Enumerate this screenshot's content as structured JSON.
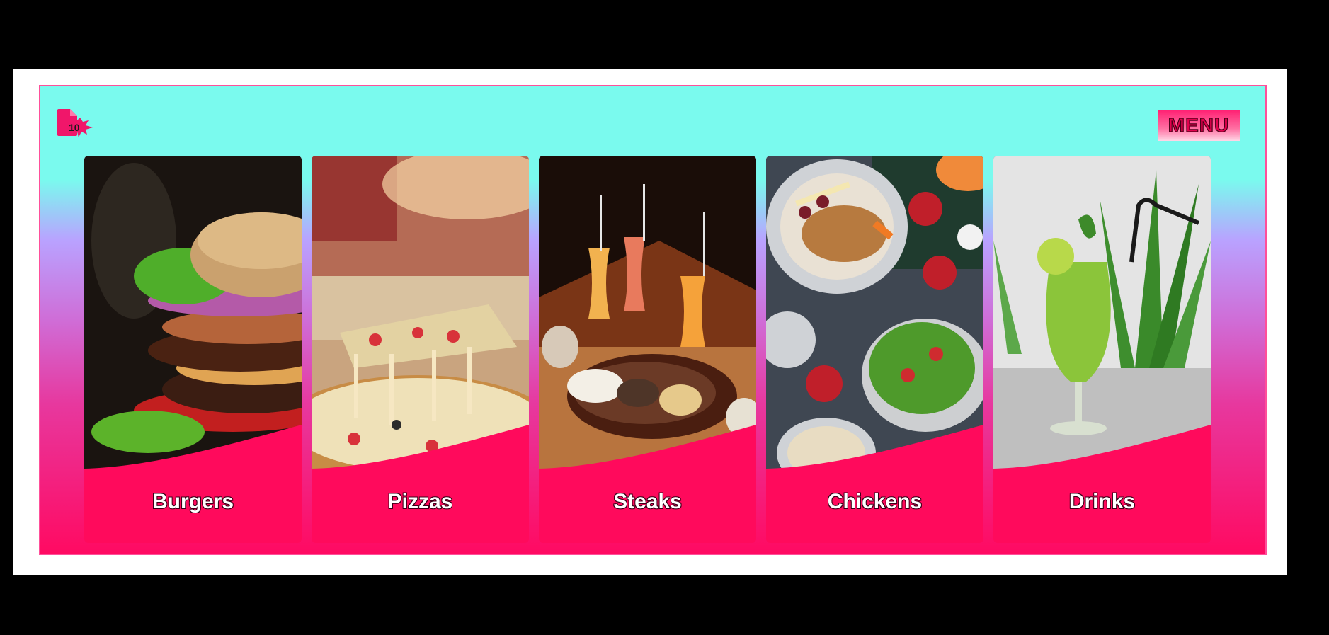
{
  "header": {
    "logo_icon": "document-badge-icon",
    "logo_badge_count": "10",
    "menu_label": "MENU"
  },
  "categories": [
    {
      "label": "Burgers",
      "image": "burger-photo"
    },
    {
      "label": "Pizzas",
      "image": "pizza-photo"
    },
    {
      "label": "Steaks",
      "image": "steak-photo"
    },
    {
      "label": "Chickens",
      "image": "chicken-photo"
    },
    {
      "label": "Drinks",
      "image": "drink-photo"
    }
  ],
  "colors": {
    "accent": "#ff0a5c",
    "top_gradient": "#7afaee",
    "mid_gradient": "#b9a2ff"
  }
}
